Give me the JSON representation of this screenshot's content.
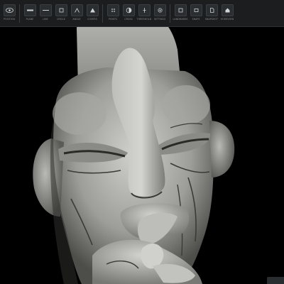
{
  "toolbar": {
    "tools": [
      {
        "label": "POSITION",
        "icon": "eye-icon"
      },
      {
        "label": "PLANE",
        "icon": "plane-icon"
      },
      {
        "label": "LINE",
        "icon": "line-icon"
      },
      {
        "label": "CIRCLE",
        "icon": "circle-icon"
      },
      {
        "label": "ANGLE",
        "icon": "angle-icon"
      },
      {
        "label": "COVERS",
        "icon": "triangle-icon"
      },
      {
        "label": "POINTS",
        "icon": "dots-icon"
      },
      {
        "label": "CROSS",
        "icon": "contrast-icon"
      },
      {
        "label": "THRESHOLD",
        "icon": "threshold-icon"
      },
      {
        "label": "SETTINGS",
        "icon": "gear-icon"
      },
      {
        "label": "LANDMARKS",
        "icon": "square-icon"
      },
      {
        "label": "SNAPS",
        "icon": "snap-icon"
      },
      {
        "label": "SNAPSHOT",
        "icon": "snapshot-icon"
      },
      {
        "label": "HOMEVIEW",
        "icon": "home-icon"
      }
    ]
  },
  "viewer": {
    "subject": "3d-rendered-carved-head"
  },
  "colors": {
    "toolbar_bg": "#1b1d1f",
    "viewport_bg": "#000000",
    "model_light": "#c9c9c5",
    "model_mid": "#8e8e8a",
    "model_dark": "#3c3c3a"
  }
}
